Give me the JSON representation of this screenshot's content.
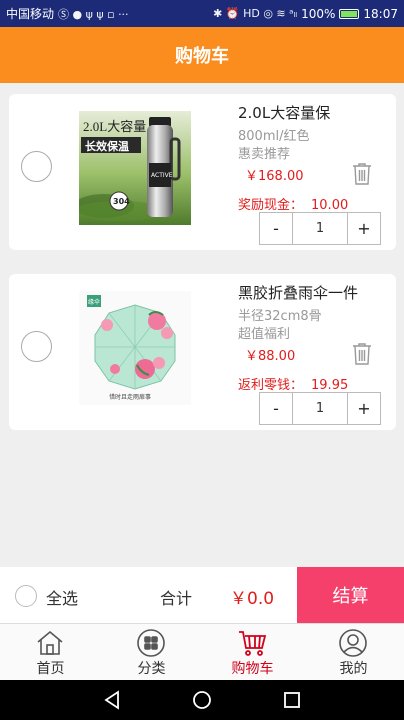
{
  "status_bar": {
    "carrier": "中国移动",
    "battery": "100%",
    "time": "18:07"
  },
  "header": {
    "title": "购物车"
  },
  "items": [
    {
      "title": "2.0L大容量保",
      "spec": "800ml/红色",
      "promo": "惠卖推荐",
      "price": "￥168.00",
      "reward_label": "奖励现金：",
      "reward_value": "10.00",
      "qty_minus": "-",
      "qty": "1",
      "qty_plus": "+",
      "image_text_1": "2.0L大容量",
      "image_text_2": "长效保温",
      "image_badge": "304"
    },
    {
      "title": "黑胶折叠雨伞一件",
      "spec": "半径32cm8骨",
      "promo": "超值福利",
      "price": "￥88.00",
      "reward_label": "返利零钱：",
      "reward_value": "19.95",
      "qty_minus": "-",
      "qty": "1",
      "qty_plus": "+",
      "image_text_1": "缘伞",
      "image_text_2": "惜时且走雨扉事"
    }
  ],
  "checkout": {
    "select_all": "全选",
    "total_label": "合计",
    "total_value": "￥0.0",
    "button": "结算"
  },
  "tabs": [
    {
      "label": "首页",
      "icon": "home-icon"
    },
    {
      "label": "分类",
      "icon": "category-icon"
    },
    {
      "label": "购物车",
      "icon": "cart-icon",
      "active": true
    },
    {
      "label": "我的",
      "icon": "profile-icon"
    }
  ],
  "colors": {
    "status_bar": "#1c2a78",
    "header": "#fb8c1e",
    "checkout_button": "#f5406c",
    "price": "#e31b1b"
  }
}
